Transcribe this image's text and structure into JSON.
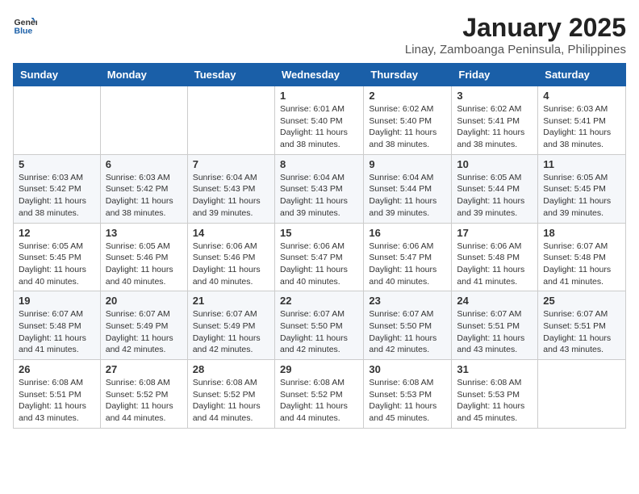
{
  "logo": {
    "text_general": "General",
    "text_blue": "Blue"
  },
  "header": {
    "month_title": "January 2025",
    "location": "Linay, Zamboanga Peninsula, Philippines"
  },
  "weekdays": [
    "Sunday",
    "Monday",
    "Tuesday",
    "Wednesday",
    "Thursday",
    "Friday",
    "Saturday"
  ],
  "weeks": [
    [
      {
        "day": "",
        "sunrise": "",
        "sunset": "",
        "daylight": ""
      },
      {
        "day": "",
        "sunrise": "",
        "sunset": "",
        "daylight": ""
      },
      {
        "day": "",
        "sunrise": "",
        "sunset": "",
        "daylight": ""
      },
      {
        "day": "1",
        "sunrise": "Sunrise: 6:01 AM",
        "sunset": "Sunset: 5:40 PM",
        "daylight": "Daylight: 11 hours and 38 minutes."
      },
      {
        "day": "2",
        "sunrise": "Sunrise: 6:02 AM",
        "sunset": "Sunset: 5:40 PM",
        "daylight": "Daylight: 11 hours and 38 minutes."
      },
      {
        "day": "3",
        "sunrise": "Sunrise: 6:02 AM",
        "sunset": "Sunset: 5:41 PM",
        "daylight": "Daylight: 11 hours and 38 minutes."
      },
      {
        "day": "4",
        "sunrise": "Sunrise: 6:03 AM",
        "sunset": "Sunset: 5:41 PM",
        "daylight": "Daylight: 11 hours and 38 minutes."
      }
    ],
    [
      {
        "day": "5",
        "sunrise": "Sunrise: 6:03 AM",
        "sunset": "Sunset: 5:42 PM",
        "daylight": "Daylight: 11 hours and 38 minutes."
      },
      {
        "day": "6",
        "sunrise": "Sunrise: 6:03 AM",
        "sunset": "Sunset: 5:42 PM",
        "daylight": "Daylight: 11 hours and 38 minutes."
      },
      {
        "day": "7",
        "sunrise": "Sunrise: 6:04 AM",
        "sunset": "Sunset: 5:43 PM",
        "daylight": "Daylight: 11 hours and 39 minutes."
      },
      {
        "day": "8",
        "sunrise": "Sunrise: 6:04 AM",
        "sunset": "Sunset: 5:43 PM",
        "daylight": "Daylight: 11 hours and 39 minutes."
      },
      {
        "day": "9",
        "sunrise": "Sunrise: 6:04 AM",
        "sunset": "Sunset: 5:44 PM",
        "daylight": "Daylight: 11 hours and 39 minutes."
      },
      {
        "day": "10",
        "sunrise": "Sunrise: 6:05 AM",
        "sunset": "Sunset: 5:44 PM",
        "daylight": "Daylight: 11 hours and 39 minutes."
      },
      {
        "day": "11",
        "sunrise": "Sunrise: 6:05 AM",
        "sunset": "Sunset: 5:45 PM",
        "daylight": "Daylight: 11 hours and 39 minutes."
      }
    ],
    [
      {
        "day": "12",
        "sunrise": "Sunrise: 6:05 AM",
        "sunset": "Sunset: 5:45 PM",
        "daylight": "Daylight: 11 hours and 40 minutes."
      },
      {
        "day": "13",
        "sunrise": "Sunrise: 6:05 AM",
        "sunset": "Sunset: 5:46 PM",
        "daylight": "Daylight: 11 hours and 40 minutes."
      },
      {
        "day": "14",
        "sunrise": "Sunrise: 6:06 AM",
        "sunset": "Sunset: 5:46 PM",
        "daylight": "Daylight: 11 hours and 40 minutes."
      },
      {
        "day": "15",
        "sunrise": "Sunrise: 6:06 AM",
        "sunset": "Sunset: 5:47 PM",
        "daylight": "Daylight: 11 hours and 40 minutes."
      },
      {
        "day": "16",
        "sunrise": "Sunrise: 6:06 AM",
        "sunset": "Sunset: 5:47 PM",
        "daylight": "Daylight: 11 hours and 40 minutes."
      },
      {
        "day": "17",
        "sunrise": "Sunrise: 6:06 AM",
        "sunset": "Sunset: 5:48 PM",
        "daylight": "Daylight: 11 hours and 41 minutes."
      },
      {
        "day": "18",
        "sunrise": "Sunrise: 6:07 AM",
        "sunset": "Sunset: 5:48 PM",
        "daylight": "Daylight: 11 hours and 41 minutes."
      }
    ],
    [
      {
        "day": "19",
        "sunrise": "Sunrise: 6:07 AM",
        "sunset": "Sunset: 5:48 PM",
        "daylight": "Daylight: 11 hours and 41 minutes."
      },
      {
        "day": "20",
        "sunrise": "Sunrise: 6:07 AM",
        "sunset": "Sunset: 5:49 PM",
        "daylight": "Daylight: 11 hours and 42 minutes."
      },
      {
        "day": "21",
        "sunrise": "Sunrise: 6:07 AM",
        "sunset": "Sunset: 5:49 PM",
        "daylight": "Daylight: 11 hours and 42 minutes."
      },
      {
        "day": "22",
        "sunrise": "Sunrise: 6:07 AM",
        "sunset": "Sunset: 5:50 PM",
        "daylight": "Daylight: 11 hours and 42 minutes."
      },
      {
        "day": "23",
        "sunrise": "Sunrise: 6:07 AM",
        "sunset": "Sunset: 5:50 PM",
        "daylight": "Daylight: 11 hours and 42 minutes."
      },
      {
        "day": "24",
        "sunrise": "Sunrise: 6:07 AM",
        "sunset": "Sunset: 5:51 PM",
        "daylight": "Daylight: 11 hours and 43 minutes."
      },
      {
        "day": "25",
        "sunrise": "Sunrise: 6:07 AM",
        "sunset": "Sunset: 5:51 PM",
        "daylight": "Daylight: 11 hours and 43 minutes."
      }
    ],
    [
      {
        "day": "26",
        "sunrise": "Sunrise: 6:08 AM",
        "sunset": "Sunset: 5:51 PM",
        "daylight": "Daylight: 11 hours and 43 minutes."
      },
      {
        "day": "27",
        "sunrise": "Sunrise: 6:08 AM",
        "sunset": "Sunset: 5:52 PM",
        "daylight": "Daylight: 11 hours and 44 minutes."
      },
      {
        "day": "28",
        "sunrise": "Sunrise: 6:08 AM",
        "sunset": "Sunset: 5:52 PM",
        "daylight": "Daylight: 11 hours and 44 minutes."
      },
      {
        "day": "29",
        "sunrise": "Sunrise: 6:08 AM",
        "sunset": "Sunset: 5:52 PM",
        "daylight": "Daylight: 11 hours and 44 minutes."
      },
      {
        "day": "30",
        "sunrise": "Sunrise: 6:08 AM",
        "sunset": "Sunset: 5:53 PM",
        "daylight": "Daylight: 11 hours and 45 minutes."
      },
      {
        "day": "31",
        "sunrise": "Sunrise: 6:08 AM",
        "sunset": "Sunset: 5:53 PM",
        "daylight": "Daylight: 11 hours and 45 minutes."
      },
      {
        "day": "",
        "sunrise": "",
        "sunset": "",
        "daylight": ""
      }
    ]
  ]
}
